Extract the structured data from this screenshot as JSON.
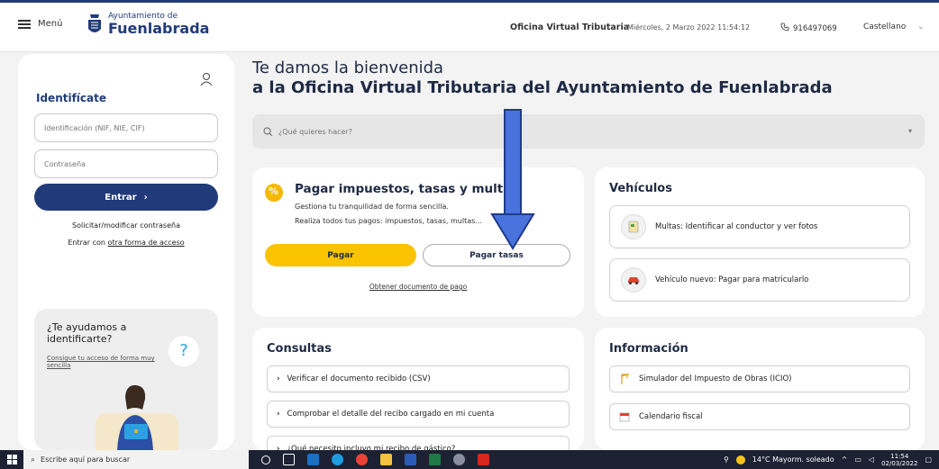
{
  "header": {
    "menu_label": "Menú",
    "logo_top": "Ayuntamiento de",
    "logo_main": "Fuenlabrada",
    "office": "Oficina Virtual Tributaria",
    "datetime": "Miércoles, 2 Marzo 2022 11:54:12",
    "phone": "916497069",
    "language": "Castellano"
  },
  "login": {
    "title": "Identifícate",
    "id_placeholder": "Identificación (NIF, NIE, CIF)",
    "password_placeholder": "Contraseña",
    "enter_label": "Entrar",
    "request_link": "Solicitar/modificar contraseña",
    "other_prefix": "Entrar con ",
    "other_link": "otra forma de acceso"
  },
  "help": {
    "title": "¿Te ayudamos a identificarte?",
    "link": "Consigue tu acceso de forma muy sencilla",
    "icon": "?"
  },
  "welcome": {
    "line1": "Te damos la bienvenida",
    "line2": "a la Oficina Virtual Tributaria del Ayuntamiento de Fuenlabrada"
  },
  "search": {
    "placeholder": "¿Qué quieres hacer?"
  },
  "pay": {
    "title": "Pagar impuestos, tasas y multas",
    "desc1": "Gestiona tu tranquilidad de forma sencilla.",
    "desc2": "Realiza todos tus pagos: impuestos, tasas, multas...",
    "pay_button": "Pagar",
    "fees_button": "Pagar tasas",
    "doc_link": "Obtener documento de pago"
  },
  "vehicles": {
    "title": "Vehículos",
    "items": [
      "Multas: Identificar al conductor y ver fotos",
      "Vehículo nuevo: Pagar para matricularlo"
    ]
  },
  "consultas": {
    "title": "Consultas",
    "items": [
      "Verificar el documento recibido (CSV)",
      "Comprobar el detalle del recibo cargado en mi cuenta",
      "¿Qué necesito incluyo mi recibo de gástico?"
    ]
  },
  "informacion": {
    "title": "Información",
    "items": [
      "Simulador del Impuesto de Obras (ICIO)",
      "Calendario fiscal"
    ]
  },
  "taskbar": {
    "search_placeholder": "Escribe aquí para buscar",
    "weather": "14°C  Mayorm. soleado",
    "time": "11:54",
    "date": "02/03/2022"
  },
  "colors": {
    "brand_blue": "#213b7a",
    "pay_yellow": "#f9c300",
    "arrow_blue": "#3f6ad8"
  }
}
